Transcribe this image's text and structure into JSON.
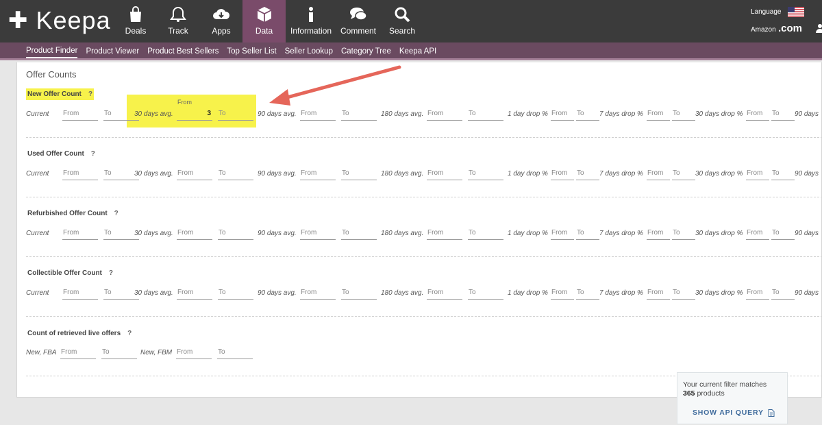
{
  "header": {
    "logo_text": "Keepa",
    "nav": [
      {
        "label": "Deals",
        "icon": "shopping-bag-icon"
      },
      {
        "label": "Track",
        "icon": "bell-icon"
      },
      {
        "label": "Apps",
        "icon": "cloud-download-icon"
      },
      {
        "label": "Data",
        "icon": "cube-icon",
        "active": true
      },
      {
        "label": "Information",
        "icon": "info-icon"
      },
      {
        "label": "Comment",
        "icon": "chat-icon"
      },
      {
        "label": "Search",
        "icon": "search-icon"
      }
    ],
    "language_label": "Language",
    "amazon_label": "Amazon",
    "domain": ".com"
  },
  "subnav": {
    "items": [
      "Product Finder",
      "Product Viewer",
      "Product Best Sellers",
      "Top Seller List",
      "Seller Lookup",
      "Category Tree",
      "Keepa API"
    ]
  },
  "section_title": "Offer Counts",
  "filter_labels": {
    "current": "Current",
    "avg30": "30 days avg.",
    "avg90": "90 days avg.",
    "avg180": "180 days avg.",
    "drop1": "1 day drop %",
    "drop7": "7 days drop %",
    "drop30": "30 days drop %",
    "drop90": "90 days",
    "from": "From",
    "to": "To",
    "help": "?"
  },
  "groups": [
    {
      "title": "New Offer Count",
      "highlighted": true,
      "from_30_value": "3"
    },
    {
      "title": "Used Offer Count"
    },
    {
      "title": "Refurbished Offer Count"
    },
    {
      "title": "Collectible Offer Count"
    }
  ],
  "live_offers": {
    "title": "Count of retrieved live offers",
    "new_fba": "New, FBA",
    "new_fbm": "New, FBM"
  },
  "match_box": {
    "line1": "Your current filter matches",
    "count": "365",
    "unit": "products",
    "button": "SHOW API QUERY"
  },
  "colors": {
    "header_bg": "#3b3b3b",
    "accent": "#7a4b6a",
    "highlight": "#f7f24b",
    "arrow": "#e5665a"
  }
}
